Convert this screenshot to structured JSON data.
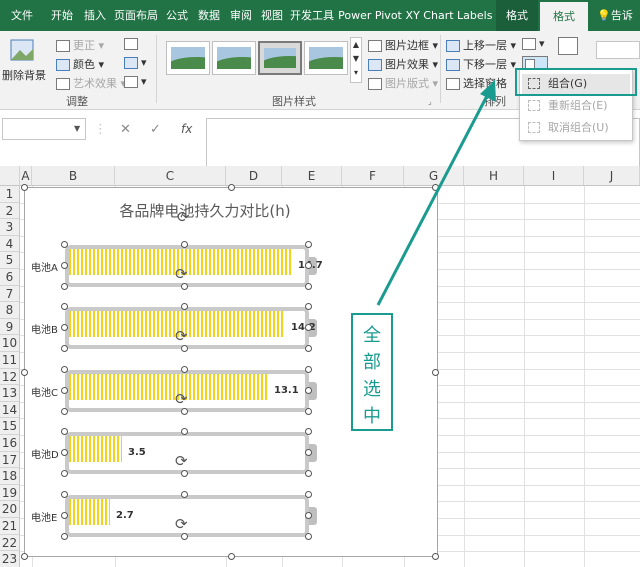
{
  "ribbon_tabs": [
    {
      "label": "文件"
    },
    {
      "label": "开始"
    },
    {
      "label": "插入"
    },
    {
      "label": "页面布局"
    },
    {
      "label": "公式"
    },
    {
      "label": "数据"
    },
    {
      "label": "审阅"
    },
    {
      "label": "视图"
    },
    {
      "label": "开发工具"
    },
    {
      "label": "Power Pivot"
    },
    {
      "label": "XY Chart Labels"
    },
    {
      "label": "格式"
    },
    {
      "label": "格式"
    },
    {
      "label": "告诉"
    }
  ],
  "adjust_group": {
    "remove_bg": "删除背景",
    "corrections": "更正",
    "color": "颜色",
    "artistic": "艺术效果",
    "label": "调整"
  },
  "styles_group": {
    "border": "图片边框",
    "effects": "图片效果",
    "layout": "图片版式",
    "label": "图片样式"
  },
  "arrange_group": {
    "bring_forward": "上移一层",
    "send_backward": "下移一层",
    "selection_pane": "选择窗格",
    "label": "排列"
  },
  "group_menu": [
    {
      "label": "组合(G)"
    },
    {
      "label": "重新组合(E)"
    },
    {
      "label": "取消组合(U)"
    }
  ],
  "columns": [
    "A",
    "B",
    "C",
    "D",
    "E",
    "F",
    "G",
    "H",
    "I",
    "J"
  ],
  "rows": [
    "1",
    "2",
    "3",
    "4",
    "5",
    "6",
    "7",
    "8",
    "9",
    "10",
    "11",
    "12",
    "13",
    "14",
    "15",
    "16",
    "17",
    "18",
    "19",
    "20",
    "21",
    "22",
    "23"
  ],
  "chart_data": {
    "type": "bar",
    "title": "各品牌电池持久力对比(h)",
    "categories": [
      "电池A",
      "电池B",
      "电池C",
      "电池D",
      "电池E"
    ],
    "values": [
      14.7,
      14.2,
      13.1,
      3.5,
      2.7
    ],
    "value_labels": [
      "14.7",
      "14.2",
      "13.1",
      "3.5",
      "2.7"
    ],
    "xlim": [
      0,
      15
    ],
    "fill_color": "#F2D21B",
    "frame_color": "#C9C9C9"
  },
  "annotation": {
    "chars": [
      "全",
      "部",
      "选",
      "中"
    ],
    "color": "#1A9B8F"
  },
  "formula_bar": {
    "fx": "fx",
    "cancel": "✕",
    "confirm": "✓"
  }
}
